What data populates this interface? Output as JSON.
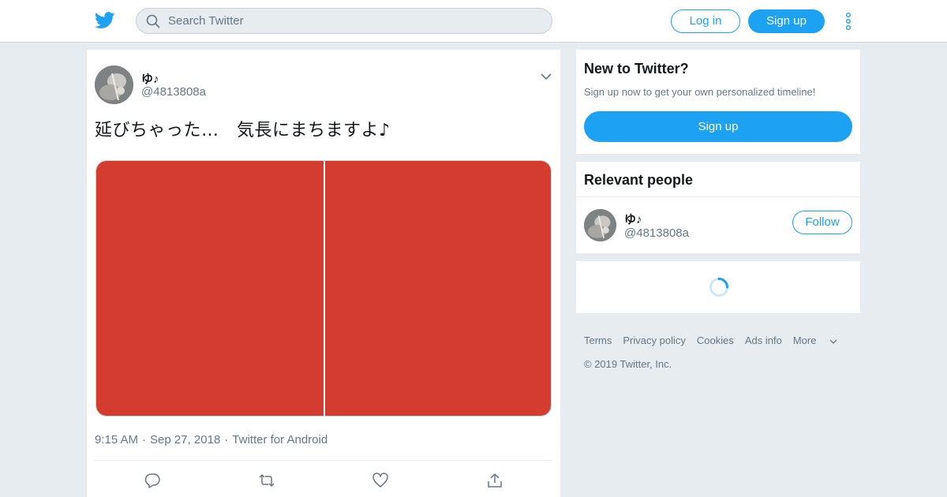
{
  "header": {
    "search_placeholder": "Search Twitter",
    "login_label": "Log in",
    "signup_label": "Sign up",
    "brand_color": "#1da1f2"
  },
  "tweet": {
    "author_name": "ゆ♪",
    "author_handle": "@4813808a",
    "text": "延びちゃった…　気長にまちますよ♪",
    "media_color": "#d33c2e",
    "time": "9:15 AM",
    "date": "Sep 27, 2018",
    "source": "Twitter for Android",
    "separator": "·",
    "actions": [
      "reply-icon",
      "retweet-icon",
      "like-icon",
      "share-icon"
    ]
  },
  "sidebar": {
    "new_to_twitter": {
      "title": "New to Twitter?",
      "subtitle": "Sign up now to get your own personalized timeline!",
      "signup_label": "Sign up"
    },
    "relevant_people": {
      "title": "Relevant people",
      "person_name": "ゆ♪",
      "person_handle": "@4813808a",
      "follow_label": "Follow"
    }
  },
  "footer": {
    "links": [
      "Terms",
      "Privacy policy",
      "Cookies",
      "Ads info",
      "More"
    ],
    "copyright": "© 2019 Twitter, Inc."
  }
}
